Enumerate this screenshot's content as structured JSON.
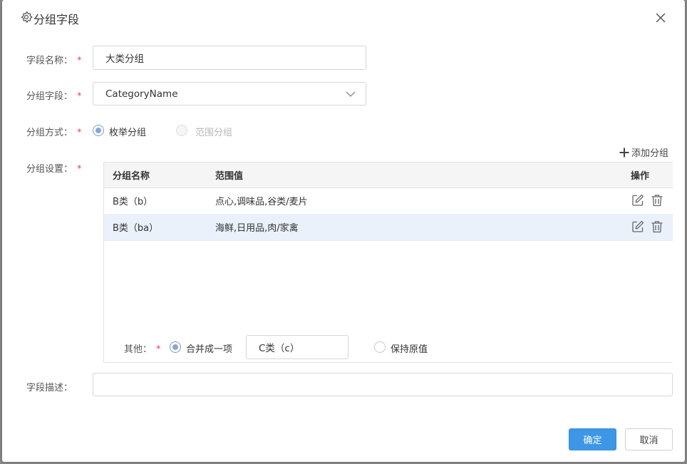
{
  "dialog": {
    "title": "分组字段",
    "title_icon": "gear-icon",
    "close_icon": "close-icon"
  },
  "form": {
    "field_name": {
      "label": "字段名称：",
      "required": "*",
      "value": "大类分组"
    },
    "group_field": {
      "label": "分组字段：",
      "required": "*",
      "value": "CategoryName"
    },
    "group_method": {
      "label": "分组方式：",
      "required": "*",
      "options": [
        {
          "label": "枚举分组",
          "selected": true,
          "disabled": false
        },
        {
          "label": "范围分组",
          "selected": false,
          "disabled": true
        }
      ]
    },
    "group_settings": {
      "label": "分组设置：",
      "required": "*",
      "add_label": "添加分组",
      "table": {
        "headers": [
          "分组名称",
          "范围值",
          "操作"
        ],
        "rows": [
          {
            "name": "B类（b）",
            "range": "点心,调味品,谷类/麦片",
            "selected": false
          },
          {
            "name": "B类（ba）",
            "range": "海鲜,日用品,肉/家禽",
            "selected": true
          }
        ]
      },
      "other": {
        "label": "其他：",
        "required": "*",
        "merge_label": "合并成一项",
        "merge_selected": true,
        "merge_value": "C类（c）",
        "keep_label": "保持原值",
        "keep_selected": false
      }
    },
    "description": {
      "label": "字段描述：",
      "value": ""
    }
  },
  "footer": {
    "ok_label": "确定",
    "cancel_label": "取消"
  },
  "colors": {
    "primary": "#3d97e6",
    "required": "#e5484d",
    "selected_row": "#eaf1fb"
  }
}
